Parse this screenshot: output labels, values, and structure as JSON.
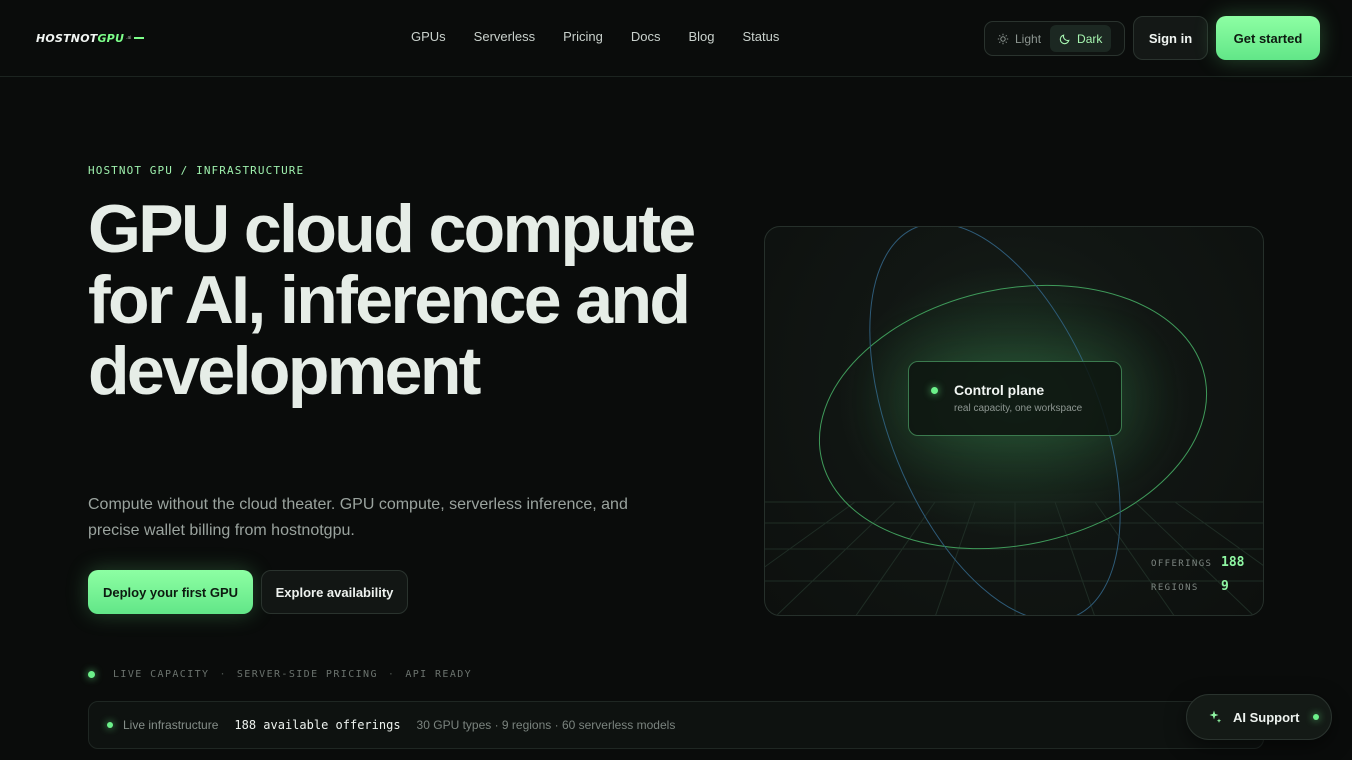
{
  "header": {
    "logo": {
      "main": "HOSTNOT",
      "accent": "GPU",
      "tail": ".ai"
    },
    "nav": [
      "GPUs",
      "Serverless",
      "Pricing",
      "Docs",
      "Blog",
      "Status"
    ],
    "theme": {
      "light_label": "Light",
      "dark_label": "Dark",
      "selected": "Dark"
    },
    "signin_label": "Sign in",
    "getstarted_label": "Get started"
  },
  "hero": {
    "eyebrow": "HOSTNOT GPU / INFRASTRUCTURE",
    "title": "GPU cloud compute for AI, inference and development",
    "subtitle": "Compute without the cloud theater. GPU compute, serverless inference, and precise wallet billing from hostnotgpu.",
    "deploy_label": "Deploy your first GPU",
    "explore_label": "Explore availability",
    "status_items": [
      "LIVE CAPACITY",
      "SERVER-SIDE PRICING",
      "API READY"
    ],
    "status_separator": "·"
  },
  "visual": {
    "card_title": "Control plane",
    "card_subtitle": "real capacity, one workspace",
    "stats": [
      {
        "label": "OFFERINGS",
        "value": "188"
      },
      {
        "label": "REGIONS",
        "value": "9"
      }
    ]
  },
  "infra": {
    "label": "Live infrastructure",
    "count": "188 available offerings",
    "detail": "30 GPU types · 9 regions · 60 serverless models"
  },
  "support": {
    "label": "AI Support"
  },
  "colors": {
    "accent": "#7dff8a",
    "background": "#0a0c0b",
    "button_green": "#6cf08a"
  }
}
